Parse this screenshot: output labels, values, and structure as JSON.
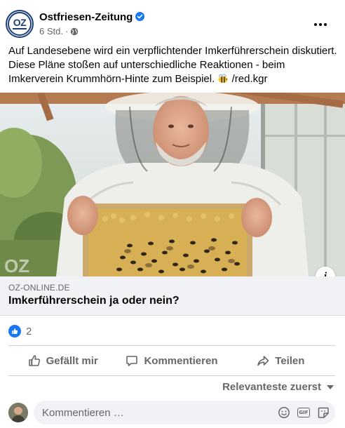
{
  "post": {
    "page_name": "Ostfriesen-Zeitung",
    "page_logo_text": "OZ",
    "time": "6 Std.",
    "separator": "·",
    "text": "Auf Landesebene wird ein verpflichtender Imkerführerschein diskutiert. Diese Pläne stoßen auf unterschiedliche Reaktionen - beim Imkerverein Krummhörn-Hinte zum Beispiel.",
    "text_suffix": "/red.kgr",
    "image_icon": "info-icon",
    "info_label": "i"
  },
  "link_preview": {
    "domain": "OZ-ONLINE.DE",
    "title": "Imkerführerschein ja oder nein?"
  },
  "reactions": {
    "icon": "like-icon",
    "count": "2"
  },
  "actions": {
    "like_label": "Gefällt mir",
    "comment_label": "Kommentieren",
    "share_label": "Teilen"
  },
  "comments": {
    "sort_label": "Relevanteste zuerst",
    "input_placeholder": "Kommentieren …"
  },
  "colors": {
    "accent": "#1877f2",
    "secondary_text": "#65676b",
    "link_box_bg": "#f0f2f5"
  }
}
